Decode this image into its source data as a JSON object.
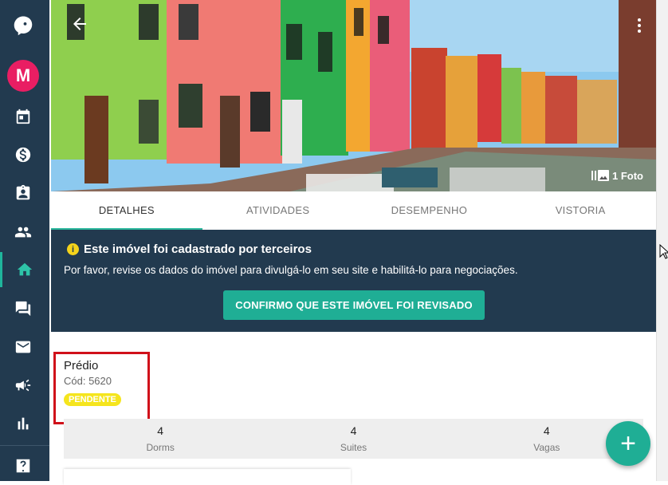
{
  "app": {
    "avatar_letter": "M",
    "accent_color": "#1fb59c",
    "sidebar_color": "#223a4f"
  },
  "sidebar": {
    "items": [
      {
        "name": "logo-icon"
      },
      {
        "name": "avatar"
      },
      {
        "name": "calendar-icon"
      },
      {
        "name": "dollar-icon"
      },
      {
        "name": "clipboard-user-icon"
      },
      {
        "name": "people-icon"
      },
      {
        "name": "home-icon",
        "active": true
      },
      {
        "name": "chat-icon"
      },
      {
        "name": "mail-icon"
      },
      {
        "name": "megaphone-icon"
      },
      {
        "name": "bar-chart-icon"
      },
      {
        "name": "help-icon"
      }
    ]
  },
  "hero": {
    "photo_count": "1 Foto"
  },
  "tabs": [
    {
      "label": "DETALHES",
      "active": true
    },
    {
      "label": "ATIVIDADES"
    },
    {
      "label": "DESEMPENHO"
    },
    {
      "label": "VISTORIA"
    }
  ],
  "banner": {
    "title": "Este imóvel foi cadastrado por terceiros",
    "text": "Por favor, revise os dados do imóvel para divulgá-lo em seu site e habilitá-lo para negociações.",
    "button": "CONFIRMO QUE ESTE IMÓVEL FOI REVISADO"
  },
  "property": {
    "type": "Prédio",
    "code": "Cód: 5620",
    "status": "PENDENTE"
  },
  "stats": [
    {
      "value": "4",
      "label": "Dorms"
    },
    {
      "value": "4",
      "label": "Suites"
    },
    {
      "value": "4",
      "label": "Vagas"
    }
  ],
  "fab": {
    "label": "+"
  }
}
